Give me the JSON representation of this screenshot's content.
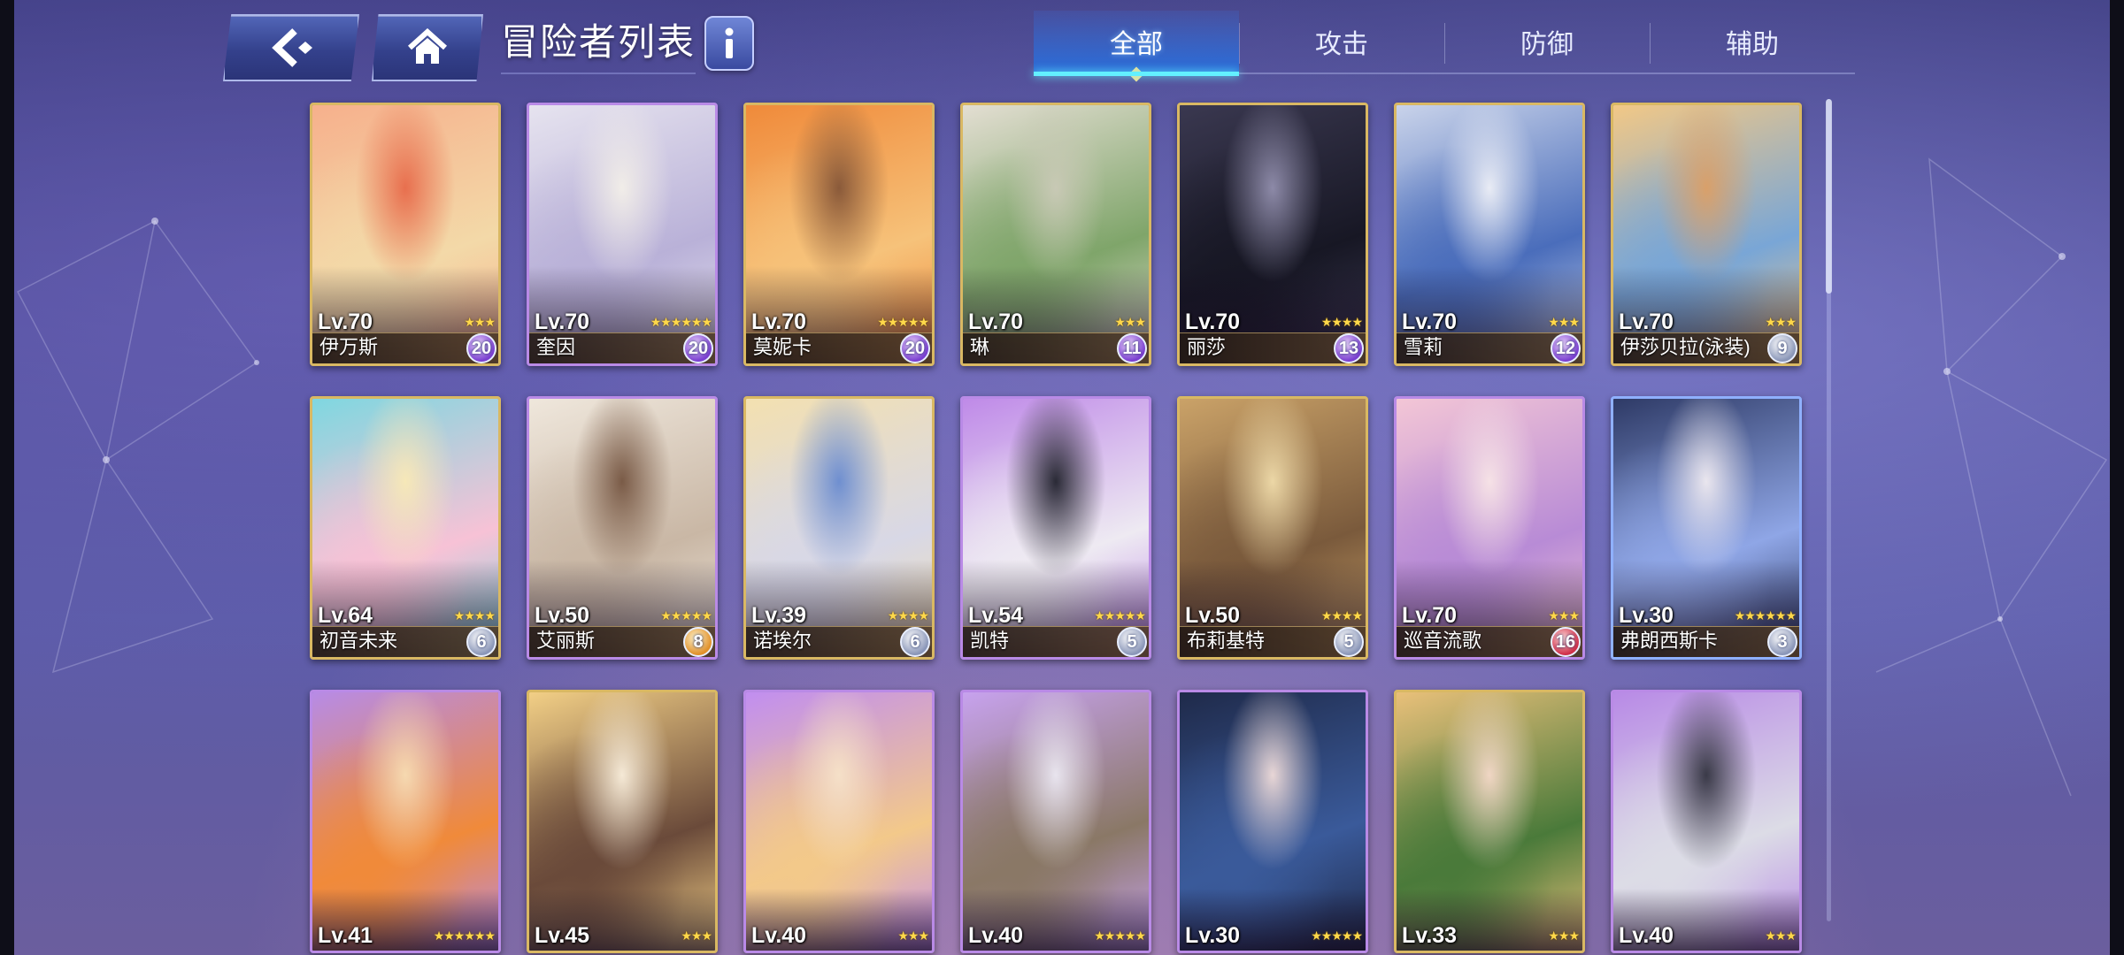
{
  "header": {
    "title": "冒险者列表",
    "back_icon": "back-arrow-icon",
    "home_icon": "home-icon",
    "info_icon": "info-icon"
  },
  "tabs": [
    {
      "label": "全部",
      "active": true
    },
    {
      "label": "攻击",
      "active": false
    },
    {
      "label": "防御",
      "active": false
    },
    {
      "label": "辅助",
      "active": false
    }
  ],
  "colors": {
    "gold_frame": "#d9b863",
    "purple_frame": "#b98ae6",
    "active_tab": "#2a6ee0",
    "accent_cyan": "#63f0ff"
  },
  "cards": [
    {
      "level": "Lv.70",
      "name": "伊万斯",
      "stars": "★★★",
      "badge": "20",
      "frame": "gold",
      "badge_color": "purple",
      "art": [
        "#f6b08c",
        "#f3d9a8",
        "#e86f4e"
      ]
    },
    {
      "level": "Lv.70",
      "name": "奎因",
      "stars": "★★★★★★",
      "badge": "20",
      "frame": "purple",
      "badge_color": "purple",
      "art": [
        "#e6e3ef",
        "#b9b1d8",
        "#f1ede8"
      ]
    },
    {
      "level": "Lv.70",
      "name": "莫妮卡",
      "stars": "★★★★★",
      "badge": "20",
      "frame": "gold",
      "badge_color": "purple",
      "art": [
        "#f08a3a",
        "#f6c27a",
        "#8a5a3a"
      ]
    },
    {
      "level": "Lv.70",
      "name": "琳",
      "stars": "★★★",
      "badge": "11",
      "frame": "gold",
      "badge_color": "purple",
      "art": [
        "#e3ded2",
        "#7fa56a",
        "#c8c9b5"
      ]
    },
    {
      "level": "Lv.70",
      "name": "丽莎",
      "stars": "★★★★",
      "badge": "13",
      "frame": "gold",
      "badge_color": "purple",
      "art": [
        "#3a3850",
        "#171724",
        "#8d8aa8"
      ]
    },
    {
      "level": "Lv.70",
      "name": "雪莉",
      "stars": "★★★",
      "badge": "12",
      "frame": "gold",
      "badge_color": "purple",
      "art": [
        "#c9d3ea",
        "#4a6dbb",
        "#e9ecf5"
      ]
    },
    {
      "level": "Lv.70",
      "name": "伊莎贝拉(泳装)",
      "stars": "★★★",
      "badge": "9",
      "frame": "gold",
      "badge_color": "gray",
      "art": [
        "#f2c886",
        "#79a6d6",
        "#d9a06a"
      ]
    },
    {
      "level": "Lv.64",
      "name": "初音未来",
      "stars": "★★★★",
      "badge": "6",
      "frame": "gold",
      "badge_color": "gray",
      "art": [
        "#7fd7e0",
        "#f7c2d6",
        "#f6e8b8"
      ]
    },
    {
      "level": "Lv.50",
      "name": "艾丽斯",
      "stars": "★★★★★",
      "badge": "8",
      "frame": "purple",
      "badge_color": "orange",
      "art": [
        "#efe7dc",
        "#c9b7a5",
        "#7a5b47"
      ]
    },
    {
      "level": "Lv.39",
      "name": "诺埃尔",
      "stars": "★★★★",
      "badge": "6",
      "frame": "gold",
      "badge_color": "gray",
      "art": [
        "#f3e0b0",
        "#d8d8e6",
        "#6f8fd0"
      ]
    },
    {
      "level": "Lv.54",
      "name": "凯特",
      "stars": "★★★★★",
      "badge": "5",
      "frame": "purple",
      "badge_color": "gray",
      "art": [
        "#bf8ae8",
        "#eeeaf2",
        "#2a2a36"
      ]
    },
    {
      "level": "Lv.50",
      "name": "布莉基特",
      "stars": "★★★★",
      "badge": "5",
      "frame": "gold",
      "badge_color": "gray",
      "art": [
        "#caa268",
        "#7a5a3c",
        "#ecd7a6"
      ]
    },
    {
      "level": "Lv.70",
      "name": "巡音流歌",
      "stars": "★★★",
      "badge": "16",
      "frame": "purple",
      "badge_color": "red",
      "art": [
        "#f3c6d6",
        "#b88bd6",
        "#f6e2e6"
      ]
    },
    {
      "level": "Lv.30",
      "name": "弗朗西斯卡",
      "stars": "★★★★★★",
      "badge": "3",
      "frame": "blue",
      "badge_color": "gray",
      "art": [
        "#2e3a66",
        "#8fa6e6",
        "#eae6ee"
      ]
    },
    {
      "level": "Lv.41",
      "name": "",
      "stars": "★★★★★★",
      "badge": "",
      "frame": "purple",
      "badge_color": "",
      "art": [
        "#b78be6",
        "#f08a3a",
        "#f6d9b0"
      ]
    },
    {
      "level": "Lv.45",
      "name": "",
      "stars": "★★★",
      "badge": "",
      "frame": "gold",
      "badge_color": "",
      "art": [
        "#f2cf86",
        "#6a4a3a",
        "#f5e9d6"
      ]
    },
    {
      "level": "Lv.40",
      "name": "",
      "stars": "★★★",
      "badge": "",
      "frame": "purple",
      "badge_color": "",
      "art": [
        "#c18ef0",
        "#f3c98a",
        "#f5e0c8"
      ]
    },
    {
      "level": "Lv.40",
      "name": "",
      "stars": "★★★★★",
      "badge": "",
      "frame": "purple",
      "badge_color": "",
      "art": [
        "#c7a2ee",
        "#8a7866",
        "#e8e4ee"
      ]
    },
    {
      "level": "Lv.30",
      "name": "",
      "stars": "★★★★★",
      "badge": "",
      "frame": "purple",
      "badge_color": "",
      "art": [
        "#1f2a4a",
        "#3a5a9a",
        "#e8d6d6"
      ]
    },
    {
      "level": "Lv.33",
      "name": "",
      "stars": "★★★",
      "badge": "",
      "frame": "gold",
      "badge_color": "",
      "art": [
        "#e9c07a",
        "#4a7a3a",
        "#f0d6c4"
      ]
    },
    {
      "level": "Lv.40",
      "name": "",
      "stars": "★★★",
      "badge": "",
      "frame": "purple",
      "badge_color": "",
      "art": [
        "#b88ae6",
        "#dcdce6",
        "#3a3a48"
      ]
    }
  ]
}
